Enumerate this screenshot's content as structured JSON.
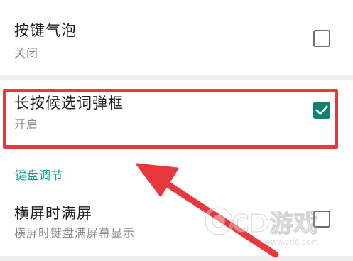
{
  "settings": {
    "items": [
      {
        "title": "按键气泡",
        "summary": "关闭",
        "checked": false
      },
      {
        "title": "长按候选词弹框",
        "summary": "开启",
        "checked": true
      },
      {
        "title": "横屏时满屏",
        "summary": "横屏时键盘满屏幕显示",
        "checked": false
      }
    ],
    "section_header": "键盘调节"
  },
  "watermark": {
    "text": "CD游戏",
    "url": "www.cd6.com"
  },
  "colors": {
    "accent": "#11826e",
    "section_header": "#1a9a84",
    "annotation": "#e8383d"
  }
}
